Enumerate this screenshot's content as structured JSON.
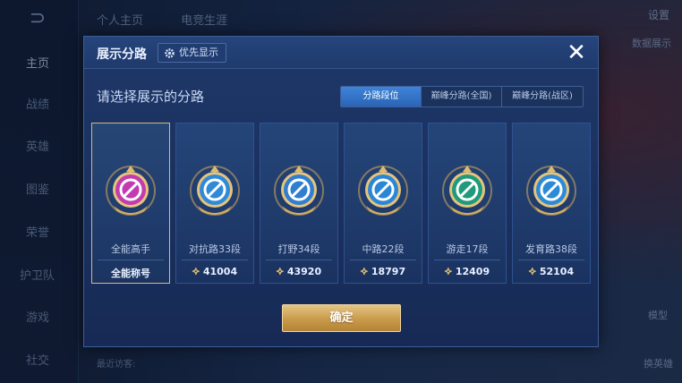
{
  "background": {
    "top_tabs": [
      "个人主页",
      "电竞生涯"
    ],
    "top_right": "设置",
    "nav_items": [
      "主页",
      "战绩",
      "英雄",
      "图鉴",
      "荣誉",
      "护卫队",
      "游戏",
      "社交"
    ],
    "side_labels": {
      "data_show": "数据展示",
      "model": "模型",
      "change_hero": "换英雄"
    },
    "bottom_visit": "最近访客:"
  },
  "dialog": {
    "title": "展示分路",
    "priority_label": "优先显示",
    "section_label": "请选择展示的分路",
    "tabs": [
      "分路段位",
      "巅峰分路(全国)",
      "巅峰分路(战区)"
    ],
    "active_tab": 0,
    "cards": [
      {
        "role": "全能高手",
        "score": "全能称号",
        "icon": "all-round-badge-icon",
        "color": "#c23bb0",
        "selected": true,
        "has_arrow": false
      },
      {
        "role": "对抗路33段",
        "score": "41004",
        "icon": "clash-lane-badge-icon",
        "color": "#2f8ad8",
        "selected": false,
        "has_arrow": true
      },
      {
        "role": "打野34段",
        "score": "43920",
        "icon": "jungle-badge-icon",
        "color": "#2f7ed0",
        "selected": false,
        "has_arrow": true
      },
      {
        "role": "中路22段",
        "score": "18797",
        "icon": "mid-lane-badge-icon",
        "color": "#2a86d6",
        "selected": false,
        "has_arrow": true
      },
      {
        "role": "游走17段",
        "score": "12409",
        "icon": "roam-badge-icon",
        "color": "#1f9a7a",
        "selected": false,
        "has_arrow": true
      },
      {
        "role": "发育路38段",
        "score": "52104",
        "icon": "farm-lane-badge-icon",
        "color": "#2d8ad6",
        "selected": false,
        "has_arrow": true
      }
    ],
    "confirm_label": "确定"
  }
}
